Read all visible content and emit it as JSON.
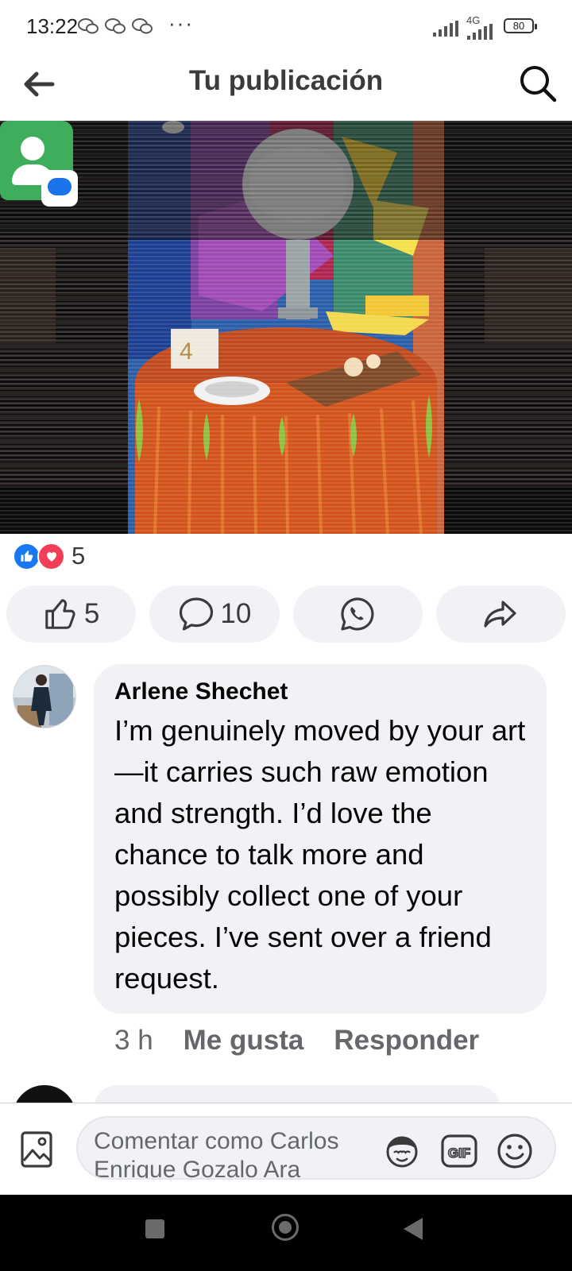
{
  "status_bar": {
    "time": "13:22",
    "notification_icons": [
      "wechat-icon",
      "wechat-icon",
      "wechat-icon"
    ],
    "more": "···",
    "network": "4G",
    "battery": "80"
  },
  "header": {
    "title": "Tu publicación",
    "back_icon": "arrow-left-icon",
    "search_icon": "search-icon"
  },
  "post": {
    "reactions": {
      "types": [
        "like",
        "love"
      ],
      "count": "5"
    },
    "actions": {
      "like_count": "5",
      "comment_count": "10",
      "whatsapp_icon": "whatsapp-icon",
      "share_icon": "share-icon"
    }
  },
  "comment": {
    "author": "Arlene Shechet",
    "text": "I’m genuinely moved by your art—it carries such raw emotion and strength. I’d love the chance to talk more and possibly collect one of your pieces. I’ve sent over a friend request.",
    "time": "3 h",
    "like_label": "Me gusta",
    "reply_label": "Responder"
  },
  "composer": {
    "placeholder": "Comentar como Carlos Enrique Gozalo Ara",
    "icons": [
      "photo-icon",
      "avatar-sticker-icon",
      "gif-icon",
      "emoji-icon"
    ]
  },
  "colors": {
    "facebook_blue": "#1877f2",
    "love_red": "#f33e58",
    "bubble_gray": "#f0f2f5",
    "secondary_text": "#65676b"
  }
}
